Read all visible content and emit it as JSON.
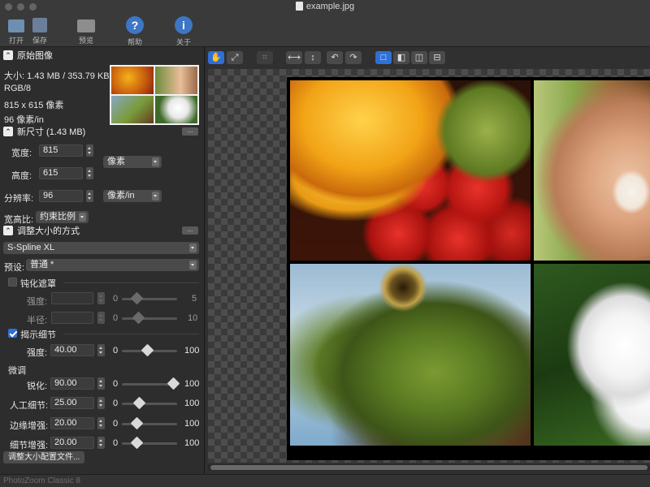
{
  "window": {
    "title": "example.jpg"
  },
  "toolbar": {
    "open": "打开",
    "save": "保存",
    "preview": "预览",
    "help": "帮助",
    "about": "关于"
  },
  "original": {
    "section_title": "原始图像",
    "size_line": "大小: 1.43 MB / 353.79 KB",
    "color_mode": "RGB/8",
    "dimensions": "815 x 615 像素",
    "resolution": "96 像素/in"
  },
  "new_size": {
    "section_title": "新尺寸 (1.43 MB)",
    "dots": "...",
    "width_label": "宽度:",
    "width_value": "815",
    "height_label": "高度:",
    "height_value": "615",
    "unit": "像素",
    "resolution_label": "分辨率:",
    "resolution_value": "96",
    "resolution_unit": "像素/in",
    "aspect_label": "宽高比:",
    "aspect_value": "约束比例"
  },
  "method": {
    "section_title": "调整大小的方式",
    "dots": "...",
    "algorithm": "S-Spline XL",
    "preset_label": "预设:",
    "preset_value": "普通 *",
    "unsharp": {
      "label": "钝化遮罩",
      "checked": false,
      "strength_label": "强度:",
      "strength_min": "0",
      "strength_max": "5",
      "radius_label": "半径:",
      "radius_min": "0",
      "radius_max": "10"
    },
    "reveal": {
      "label": "揭示细节",
      "checked": true,
      "strength_label": "强度:",
      "strength_value": "40.00",
      "strength_min": "0",
      "strength_max": "100",
      "strength_level": 0.4
    },
    "fine_tune": {
      "title": "微调",
      "rows": [
        {
          "label": "锐化:",
          "value": "90.00",
          "min": "0",
          "max": "100",
          "level": 0.9
        },
        {
          "label": "人工细节:",
          "value": "25.00",
          "min": "0",
          "max": "100",
          "level": 0.25
        },
        {
          "label": "边缘增强:",
          "value": "20.00",
          "min": "0",
          "max": "100",
          "level": 0.2
        },
        {
          "label": "细节增强:",
          "value": "20.00",
          "min": "0",
          "max": "100",
          "level": 0.2
        }
      ]
    },
    "profile_button": "调整大小配置文件..."
  },
  "canvas_tools": {
    "hand": "✋",
    "zoom": "⤢",
    "crop": "⌗",
    "flip_h": "⟷",
    "flip_v": "↕",
    "rotate_left": "↶",
    "rotate_right": "↷",
    "view_single": "□",
    "view_split": "◧",
    "view_side": "◫",
    "view_stack": "⊟"
  },
  "statusbar": {
    "text": "PhotoZoom Classic 8"
  }
}
